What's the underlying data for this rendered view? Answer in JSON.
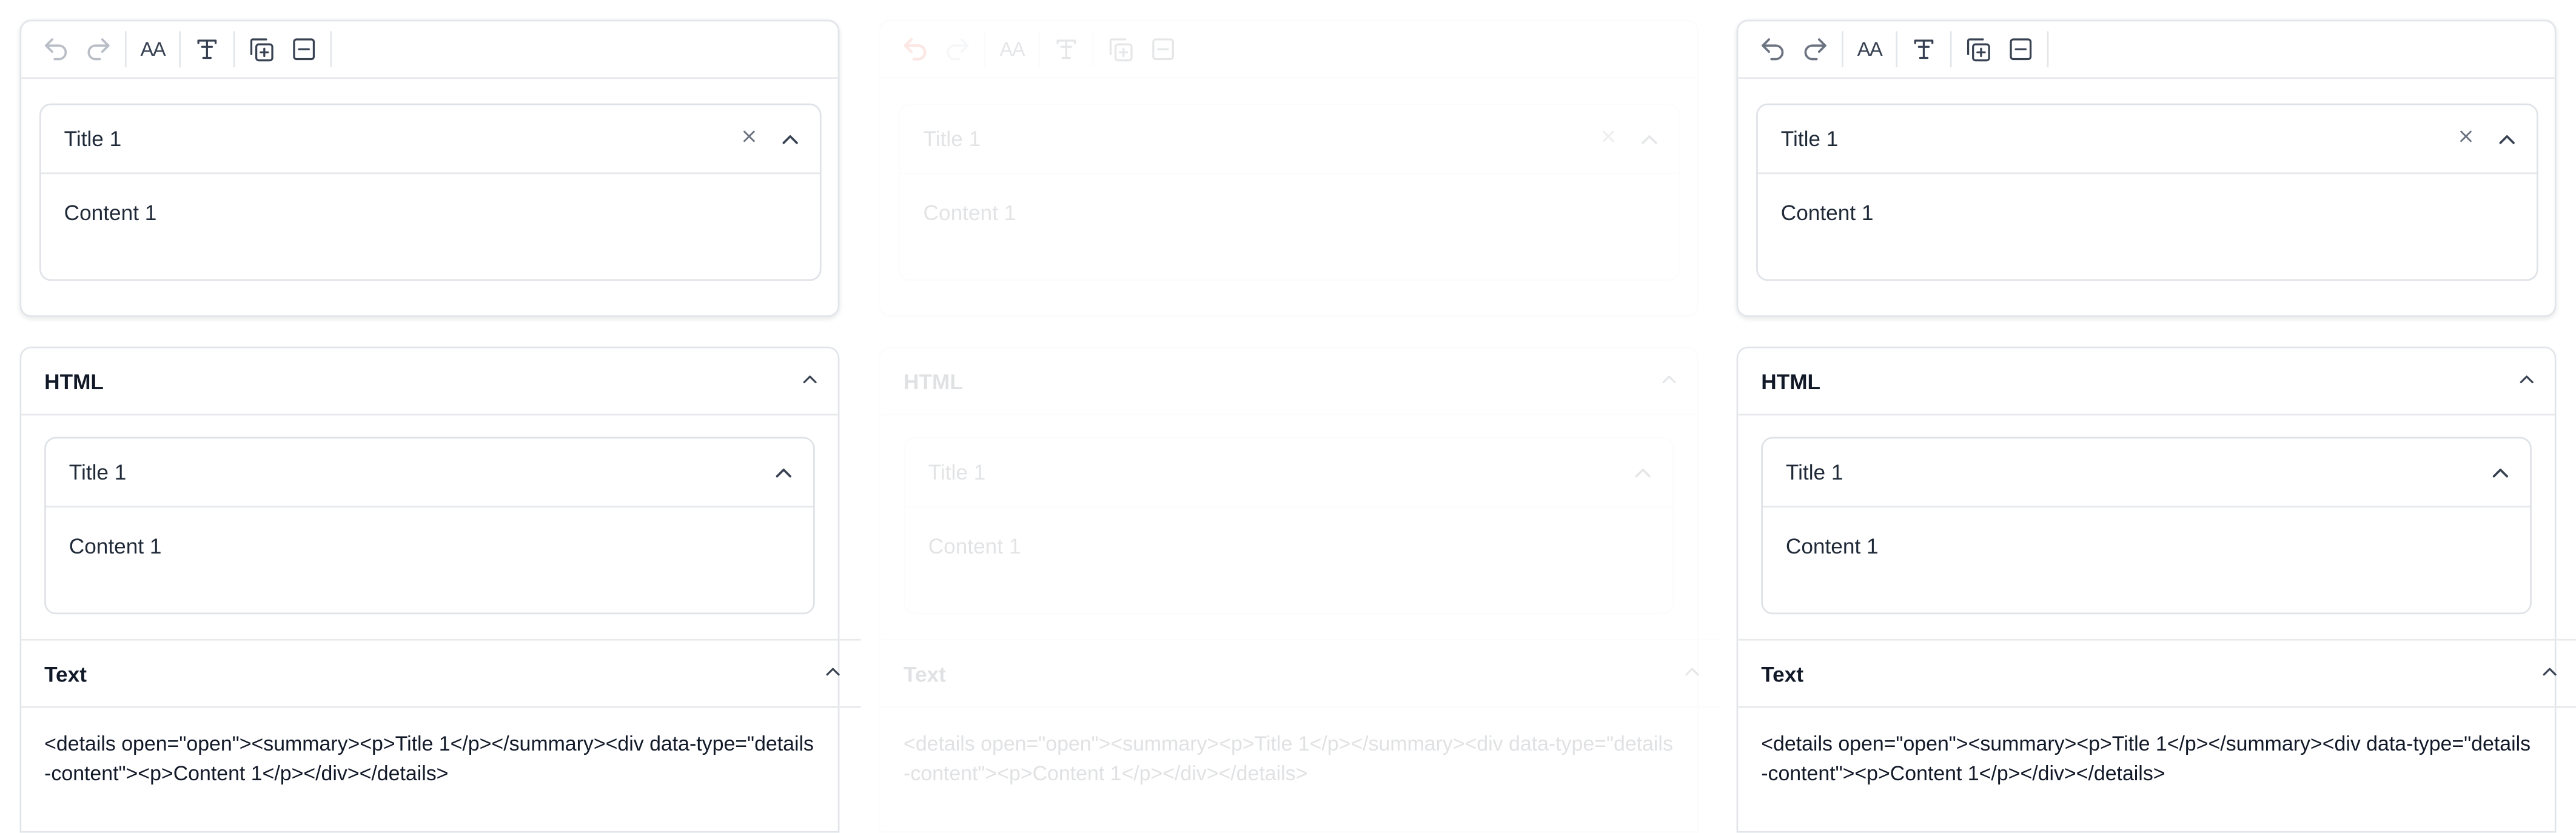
{
  "toolbar": {
    "undo_icon": "undo-icon",
    "redo_icon": "redo-icon",
    "text_size_icon": "text-size-icon",
    "clear_format_icon": "clear-format-icon",
    "add_details_icon": "add-details-icon",
    "remove_details_icon": "remove-details-icon",
    "text_size_label": "AA",
    "undo_active_color": "#e0452f"
  },
  "columns": [
    {
      "state": "normal",
      "editor": {
        "title": "Title 1",
        "content": "Content 1"
      },
      "html_panel": {
        "label": "HTML",
        "title": "Title 1",
        "content": "Content 1"
      },
      "text_panel": {
        "label": "Text",
        "code": "<details open=\"open\"><summary><p>Title 1</p></summary><div data-type=\"details-content\"><p>Content 1</p></div></details>"
      }
    },
    {
      "state": "faded",
      "editor": {
        "title": "Title 1",
        "content": "Content 1"
      },
      "html_panel": {
        "label": "HTML",
        "title": "Title 1",
        "content": "Content 1"
      },
      "text_panel": {
        "label": "Text",
        "code": "<details open=\"open\"><summary><p>Title 1</p></summary><div data-type=\"details-content\"><p>Content 1</p></div></details>"
      }
    },
    {
      "state": "normal",
      "editor": {
        "title": "Title 1",
        "content": "Content 1"
      },
      "html_panel": {
        "label": "HTML",
        "title": "Title 1",
        "content": "Content 1"
      },
      "text_panel": {
        "label": "Text",
        "code": "<details open=\"open\"><summary><p>Title 1</p></summary><div data-type=\"details-content\"><p>Content 1</p></div></details>"
      }
    }
  ]
}
